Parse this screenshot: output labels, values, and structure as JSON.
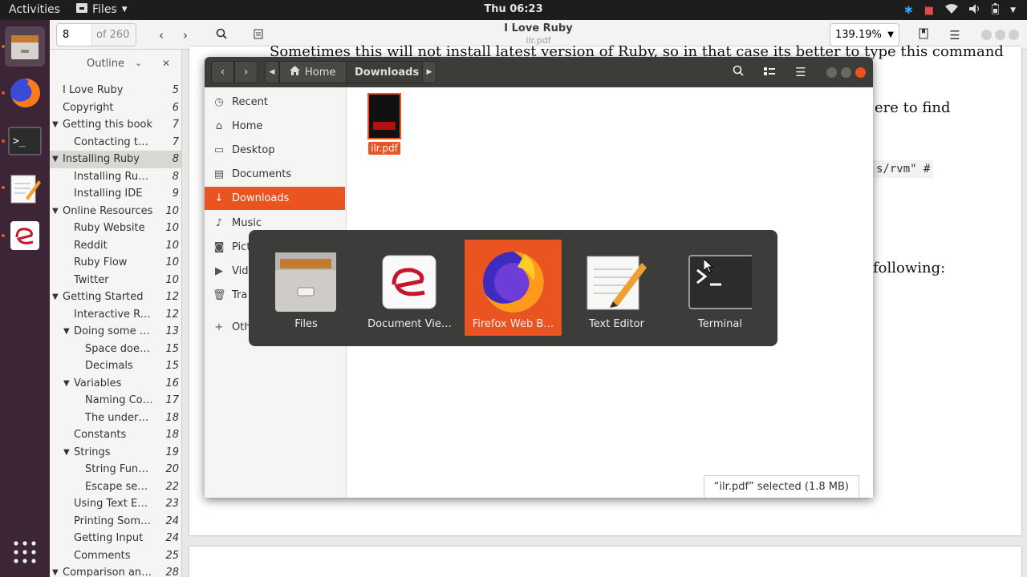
{
  "topbar": {
    "activities": "Activities",
    "app": "Files",
    "clock": "Thu 06:23"
  },
  "evince": {
    "page_current": "8",
    "page_total": "of 260",
    "title": "I Love Ruby",
    "subtitle": "ilr.pdf",
    "zoom": "139.19%"
  },
  "outline": {
    "title": "Outline",
    "items": [
      {
        "label": "I Love Ruby",
        "page": "5",
        "level": 0,
        "arrow": ""
      },
      {
        "label": "Copyright",
        "page": "6",
        "level": 0,
        "arrow": ""
      },
      {
        "label": "Getting this book",
        "page": "7",
        "level": 0,
        "arrow": "▼"
      },
      {
        "label": "Contacting th…",
        "page": "7",
        "level": 1,
        "arrow": ""
      },
      {
        "label": "Installing Ruby",
        "page": "8",
        "level": 0,
        "arrow": "▼",
        "selected": true
      },
      {
        "label": "Installing Rub…",
        "page": "8",
        "level": 1,
        "arrow": ""
      },
      {
        "label": "Installing IDE",
        "page": "9",
        "level": 1,
        "arrow": ""
      },
      {
        "label": "Online Resources",
        "page": "10",
        "level": 0,
        "arrow": "▼"
      },
      {
        "label": "Ruby Website",
        "page": "10",
        "level": 1,
        "arrow": ""
      },
      {
        "label": "Reddit",
        "page": "10",
        "level": 1,
        "arrow": ""
      },
      {
        "label": "Ruby Flow",
        "page": "10",
        "level": 1,
        "arrow": ""
      },
      {
        "label": "Twitter",
        "page": "10",
        "level": 1,
        "arrow": ""
      },
      {
        "label": "Getting Started",
        "page": "12",
        "level": 0,
        "arrow": "▼"
      },
      {
        "label": "Interactive Ruby",
        "page": "12",
        "level": 1,
        "arrow": ""
      },
      {
        "label": "Doing some …",
        "page": "13",
        "level": 1,
        "arrow": "▼"
      },
      {
        "label": "Space does…",
        "page": "15",
        "level": 2,
        "arrow": ""
      },
      {
        "label": "Decimals",
        "page": "15",
        "level": 2,
        "arrow": ""
      },
      {
        "label": "Variables",
        "page": "16",
        "level": 1,
        "arrow": "▼"
      },
      {
        "label": "Naming Co…",
        "page": "17",
        "level": 2,
        "arrow": ""
      },
      {
        "label": "The unders…",
        "page": "18",
        "level": 2,
        "arrow": ""
      },
      {
        "label": "Constants",
        "page": "18",
        "level": 1,
        "arrow": ""
      },
      {
        "label": "Strings",
        "page": "19",
        "level": 1,
        "arrow": "▼"
      },
      {
        "label": "String Func…",
        "page": "20",
        "level": 2,
        "arrow": ""
      },
      {
        "label": "Escape seq…",
        "page": "22",
        "level": 2,
        "arrow": ""
      },
      {
        "label": "Using Text Edi…",
        "page": "23",
        "level": 1,
        "arrow": ""
      },
      {
        "label": "Printing Som…",
        "page": "24",
        "level": 1,
        "arrow": ""
      },
      {
        "label": "Getting Input",
        "page": "24",
        "level": 1,
        "arrow": ""
      },
      {
        "label": "Comments",
        "page": "25",
        "level": 1,
        "arrow": ""
      },
      {
        "label": "Comparison an…",
        "page": "28",
        "level": 0,
        "arrow": "▼"
      }
    ]
  },
  "document": {
    "line1": "Sometimes this will not install latest version of Ruby, so in that case its better to type this command",
    "line2": "ere to find",
    "code": "s/rvm\"  #",
    "line3": "following:"
  },
  "files": {
    "breadcrumb": [
      "Home",
      "Downloads"
    ],
    "places": [
      {
        "label": "Recent",
        "icon": "clock-icon"
      },
      {
        "label": "Home",
        "icon": "home-icon"
      },
      {
        "label": "Desktop",
        "icon": "desktop-icon"
      },
      {
        "label": "Documents",
        "icon": "documents-icon"
      },
      {
        "label": "Downloads",
        "icon": "downloads-icon",
        "selected": true
      },
      {
        "label": "Music",
        "icon": "music-icon"
      },
      {
        "label": "Pict",
        "icon": "pictures-icon"
      },
      {
        "label": "Vid",
        "icon": "videos-icon"
      },
      {
        "label": "Tra",
        "icon": "trash-icon"
      },
      {
        "label": "Oth",
        "icon": "plus-icon"
      }
    ],
    "file_name": "ilr.pdf",
    "status": "“ilr.pdf” selected  (1.8 MB)"
  },
  "switcher": {
    "apps": [
      {
        "label": "Files",
        "icon": "files-icon"
      },
      {
        "label": "Document Vie…",
        "icon": "document-viewer-icon"
      },
      {
        "label": "Firefox Web B…",
        "icon": "firefox-icon",
        "selected": true
      },
      {
        "label": "Text Editor",
        "icon": "text-editor-icon"
      },
      {
        "label": "Terminal",
        "icon": "terminal-icon"
      }
    ]
  },
  "colors": {
    "accent": "#e95420",
    "dock": "#3b2536",
    "topbar": "#1d1d1d",
    "headerbar": "#3d3c39"
  }
}
